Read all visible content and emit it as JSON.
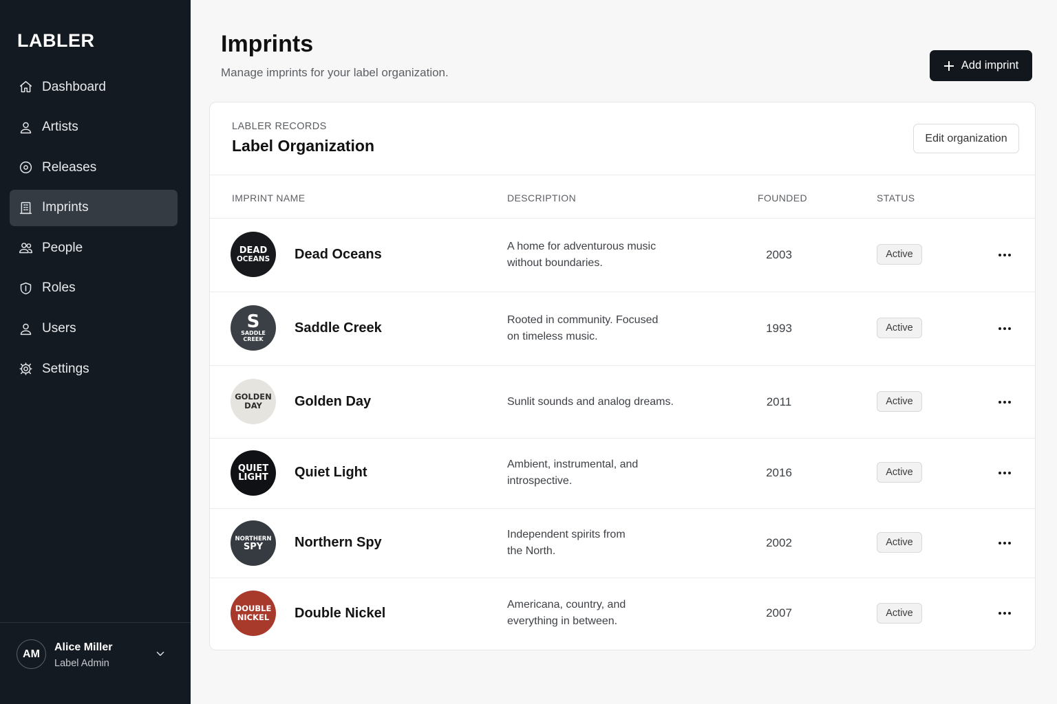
{
  "app": {
    "brand": "LABLER"
  },
  "sidebar": {
    "items": [
      {
        "label": "Dashboard",
        "icon": "home-icon",
        "active": false
      },
      {
        "label": "Artists",
        "icon": "user-icon",
        "active": false
      },
      {
        "label": "Releases",
        "icon": "disc-icon",
        "active": false
      },
      {
        "label": "Imprints",
        "icon": "building-icon",
        "active": true
      },
      {
        "label": "People",
        "icon": "people-icon",
        "active": false
      },
      {
        "label": "Roles",
        "icon": "shield-icon",
        "active": false
      },
      {
        "label": "Users",
        "icon": "user-icon",
        "active": false
      },
      {
        "label": "Settings",
        "icon": "gear-icon",
        "active": false
      }
    ],
    "user": {
      "initials": "AM",
      "name": "Alice Miller",
      "role": "Label Admin"
    }
  },
  "header": {
    "title": "Imprints",
    "subtitle": "Manage imprints for your label organization.",
    "add_label": "Add imprint"
  },
  "organization": {
    "eyebrow": "LABLER RECORDS",
    "name": "Label Organization",
    "edit_label": "Edit organization"
  },
  "table": {
    "columns": [
      "IMPRINT NAME",
      "DESCRIPTION",
      "FOUNDED",
      "STATUS"
    ],
    "rows": [
      {
        "name": "Dead Oceans",
        "logo_line1": "DEAD",
        "logo_line2": "OCEANS",
        "logo_bg": "#17191c",
        "logo_fg": "#ffffff",
        "desc_line1": "A home for adventurous music",
        "desc_line2": "without boundaries.",
        "founded": "2003",
        "status": "Active"
      },
      {
        "name": "Saddle Creek",
        "logo_line1": "S",
        "logo_line2": "SADDLE CREEK",
        "logo_bg": "#3a4045",
        "logo_fg": "#ffffff",
        "desc_line1": "Rooted in community. Focused",
        "desc_line2": "on timeless music.",
        "founded": "1993",
        "status": "Active"
      },
      {
        "name": "Golden Day",
        "logo_line1": "GOLDEN",
        "logo_line2": "DAY",
        "logo_bg": "#e6e4df",
        "logo_fg": "#2b2b2b",
        "desc_line1": "Sunlit sounds and analog dreams.",
        "desc_line2": "",
        "founded": "2011",
        "status": "Active"
      },
      {
        "name": "Quiet Light",
        "logo_line1": "QUIET",
        "logo_line2": "LIGHT",
        "logo_bg": "#0f1114",
        "logo_fg": "#ffffff",
        "desc_line1": "Ambient, instrumental, and",
        "desc_line2": "introspective.",
        "founded": "2016",
        "status": "Active"
      },
      {
        "name": "Northern Spy",
        "logo_line1": "NORTHERN",
        "logo_line2": "SPY",
        "logo_bg": "#353b40",
        "logo_fg": "#ffffff",
        "desc_line1": "Independent spirits from",
        "desc_line2": "the North.",
        "founded": "2002",
        "status": "Active"
      },
      {
        "name": "Double Nickel",
        "logo_line1": "DOUBLE",
        "logo_line2": "NICKEL",
        "logo_bg": "#a83a2c",
        "logo_fg": "#ffffff",
        "desc_line1": "Americana, country, and",
        "desc_line2": "everything in between.",
        "founded": "2007",
        "status": "Active"
      }
    ]
  },
  "colors": {
    "sidebar_bg": "#141a21",
    "active_item_bg": "#343b43",
    "primary_button": "#12171d"
  }
}
